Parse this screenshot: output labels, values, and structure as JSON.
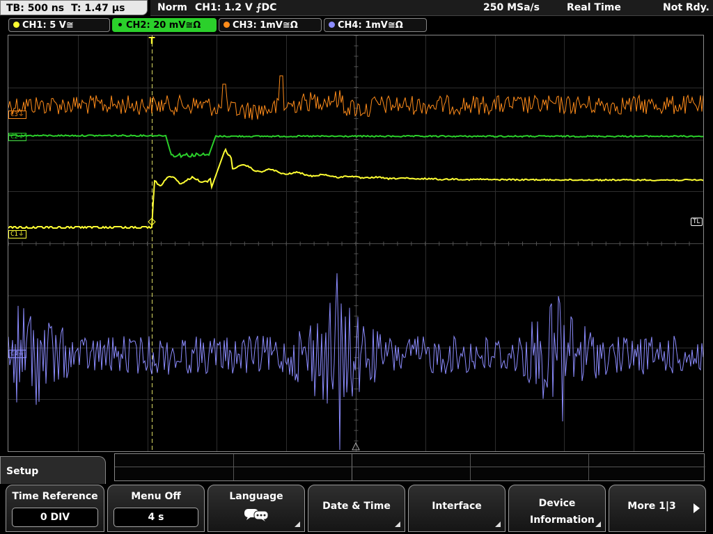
{
  "status": {
    "timebase": "TB: 500 ns",
    "trigger_time": "T: 1.47 µs",
    "mode": "Norm",
    "trigger": "CH1: 1.2 V ⨍DC",
    "sample_rate": "250 MSa/s",
    "acquisition": "Real Time",
    "state": "Not Rdy."
  },
  "channels": [
    {
      "label": "CH1: 5 V≅",
      "color": "#ffff33"
    },
    {
      "label": "CH2: 20 mV≅Ω",
      "color": "#2bd02b",
      "active": true
    },
    {
      "label": "CH3: 1mV≅Ω",
      "color": "#ff8c1a"
    },
    {
      "label": "CH4: 1mV≅Ω",
      "color": "#8c8cff"
    }
  ],
  "markers": {
    "ch1": "C1⏚",
    "ch2": "C2⏚",
    "ch3": "C3⏚",
    "ch4": "C4⏚",
    "trigger_level": "TL",
    "trigger_position": "T"
  },
  "menu": {
    "title": "Setup",
    "softkeys": [
      {
        "label": "Time Reference",
        "value": "0 DIV"
      },
      {
        "label": "Menu Off",
        "value": "4 s"
      },
      {
        "label": "Language",
        "icon": "speech-bubbles-icon"
      },
      {
        "label": "Date & Time"
      },
      {
        "label": "Interface"
      },
      {
        "label": "Device Information"
      },
      {
        "label": "More 1|3"
      }
    ]
  }
}
